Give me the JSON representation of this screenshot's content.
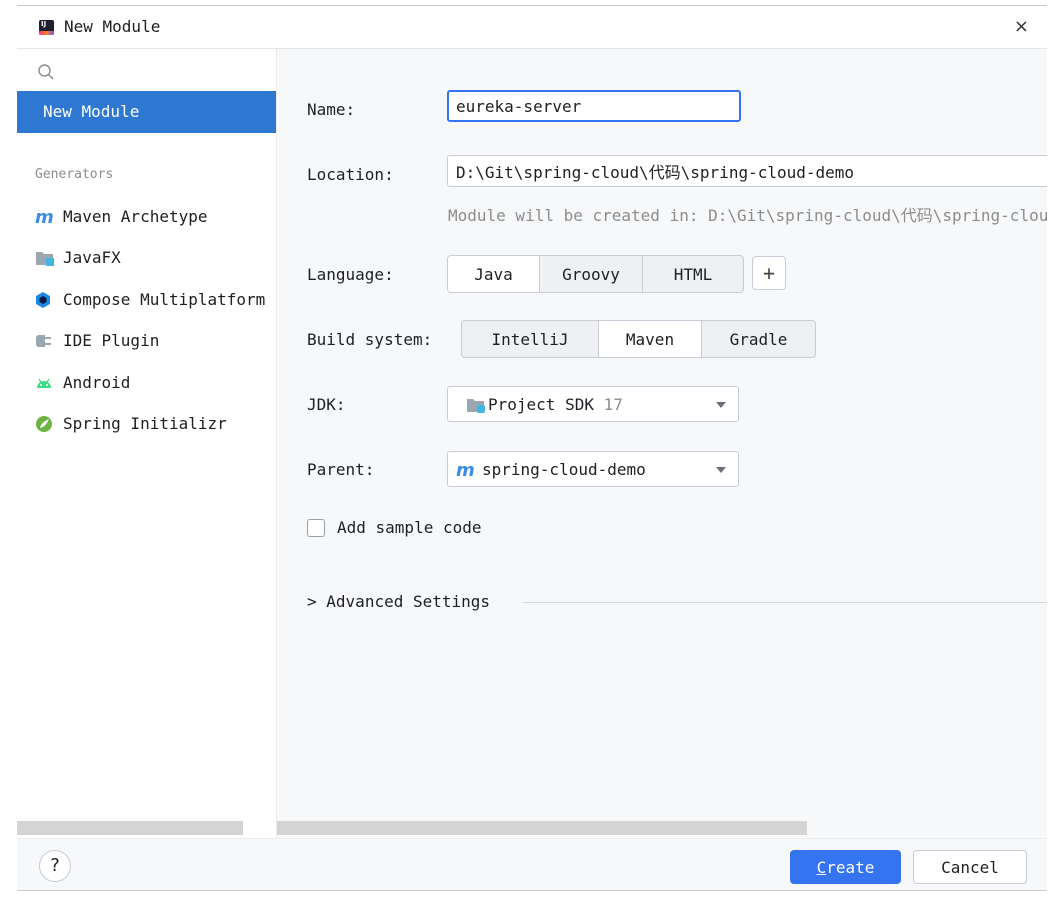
{
  "window": {
    "title": "New Module",
    "close_glyph": "×"
  },
  "sidebar": {
    "selected": "New Module",
    "generators_header": "Generators",
    "generators": [
      {
        "label": "Maven Archetype",
        "icon": "maven-icon"
      },
      {
        "label": "JavaFX",
        "icon": "folder-icon"
      },
      {
        "label": "Compose Multiplatform",
        "icon": "compose-icon"
      },
      {
        "label": "IDE Plugin",
        "icon": "plugin-icon"
      },
      {
        "label": "Android",
        "icon": "android-icon"
      },
      {
        "label": "Spring Initializr",
        "icon": "spring-icon"
      }
    ]
  },
  "form": {
    "name_label": "Name:",
    "name_value": "eureka-server",
    "location_label": "Location:",
    "location_value": "D:\\Git\\spring-cloud\\代码\\spring-cloud-demo",
    "location_hint": "Module will be created in: D:\\Git\\spring-cloud\\代码\\spring-cloud-demo\\eureka-server",
    "language_label": "Language:",
    "languages": [
      "Java",
      "Groovy",
      "HTML"
    ],
    "language_selected": "Java",
    "add_glyph": "+",
    "build_label": "Build system:",
    "build_systems": [
      "IntelliJ",
      "Maven",
      "Gradle"
    ],
    "build_selected": "Maven",
    "jdk_label": "JDK:",
    "jdk_name": "Project SDK",
    "jdk_version": "17",
    "parent_label": "Parent:",
    "parent_value": "spring-cloud-demo",
    "sample_code_label": "Add sample code",
    "sample_code_checked": false,
    "advanced_glyph": ">",
    "advanced_label": "Advanced Settings"
  },
  "footer": {
    "help_glyph": "?",
    "create_mnemonic": "C",
    "create_rest": "reate",
    "cancel_label": "Cancel"
  },
  "colors": {
    "accent": "#3574f0",
    "selected_nav": "#2f78d1"
  }
}
